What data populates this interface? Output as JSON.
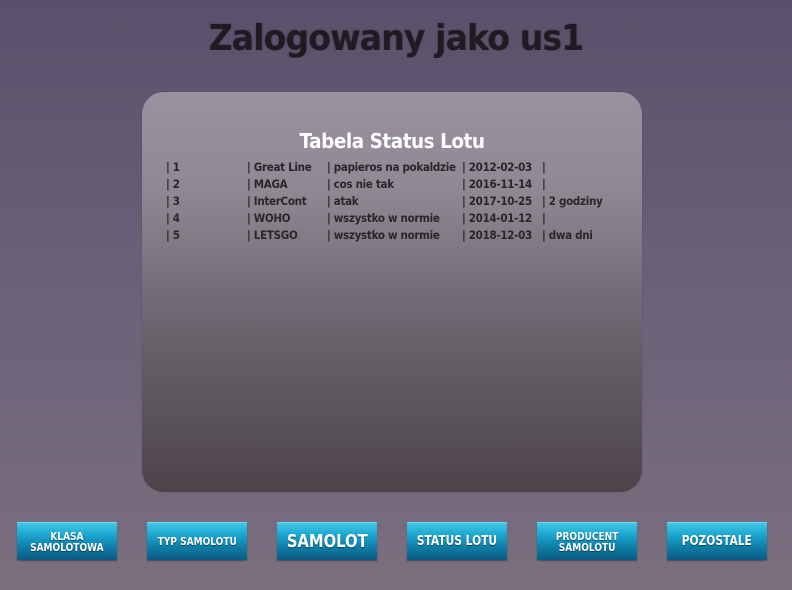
{
  "header": {
    "title": "Zalogowany jako us1"
  },
  "panel": {
    "title": "Tabela Status Lotu",
    "rows": [
      {
        "id": "| 1",
        "company": "| Great Line",
        "status": "| papieros na pokaldzie",
        "date": "| 2012-02-03",
        "delay": "|"
      },
      {
        "id": "| 2",
        "company": "| MAGA",
        "status": "| cos nie tak",
        "date": "| 2016-11-14",
        "delay": "|"
      },
      {
        "id": "| 3",
        "company": "| InterCont",
        "status": "| atak",
        "date": "| 2017-10-25",
        "delay": "| 2 godziny"
      },
      {
        "id": "| 4",
        "company": "| WOHO",
        "status": "| wszystko w normie",
        "date": "| 2014-01-12",
        "delay": "|"
      },
      {
        "id": "| 5",
        "company": "| LETSGO",
        "status": "| wszystko w normie",
        "date": "| 2018-12-03",
        "delay": "| dwa dni"
      }
    ]
  },
  "nav": {
    "klasa": "KLASA\nSAMOLOTOWA",
    "typ": "TYP SAMOLOTU",
    "samolot": "SAMOLOT",
    "status": "STATUS LOTU",
    "producent": "PRODUCENT\nSAMOLOTU",
    "pozostale": "POZOSTALE"
  },
  "colors": {
    "button_top": "#3fc8e8",
    "button_bottom": "#0a5b80",
    "panel_top": "#9a92a0",
    "panel_bottom": "#4c4449"
  }
}
